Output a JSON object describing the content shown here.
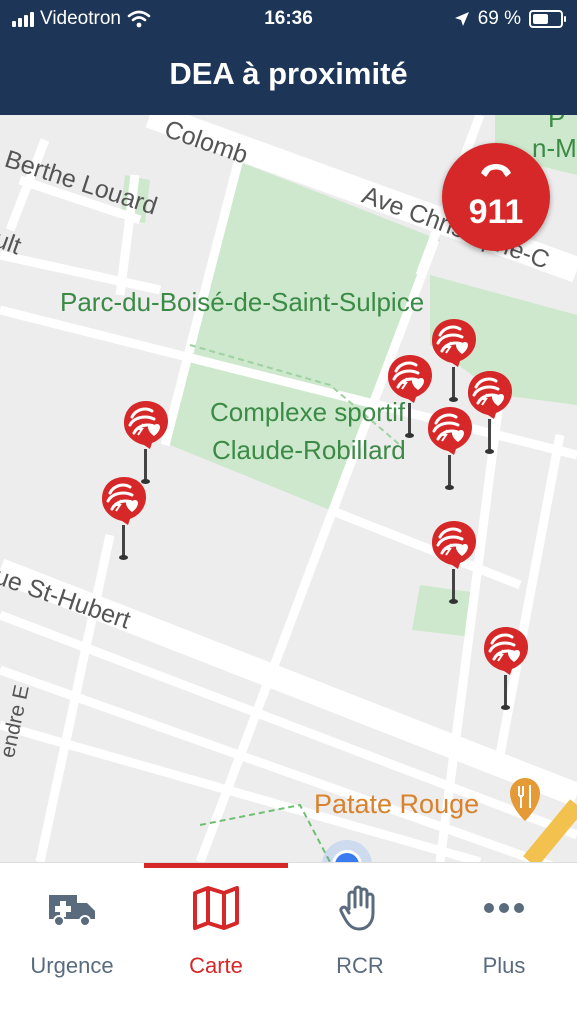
{
  "status_bar": {
    "carrier": "Videotron",
    "time": "16:36",
    "battery": "69 %",
    "battery_level": 0.69
  },
  "header": {
    "title": "DEA à proximité"
  },
  "map": {
    "streets": [
      "Berthe Louard",
      "Colomb",
      "Ave Christophe-C",
      "ult",
      "ue St-Hubert",
      "endre E"
    ],
    "places": [
      "Parc-du-Boisé-de-Saint-Sulpice",
      "Complexe sportif",
      "Claude-Robillard",
      "P",
      "n-M"
    ],
    "poi": "Patate Rouge",
    "emergency_call": "911",
    "aed_marker_count": 8
  },
  "colors": {
    "header_bg": "#1d3557",
    "accent_red": "#d62828",
    "park_green": "#cde8cc",
    "map_bg": "#ededed",
    "tab_inactive": "#5a6b7e"
  },
  "tabs": [
    {
      "label": "Urgence",
      "icon": "ambulance-icon",
      "active": false
    },
    {
      "label": "Carte",
      "icon": "map-icon",
      "active": true
    },
    {
      "label": "RCR",
      "icon": "hand-icon",
      "active": false
    },
    {
      "label": "Plus",
      "icon": "more-dots-icon",
      "active": false
    }
  ]
}
